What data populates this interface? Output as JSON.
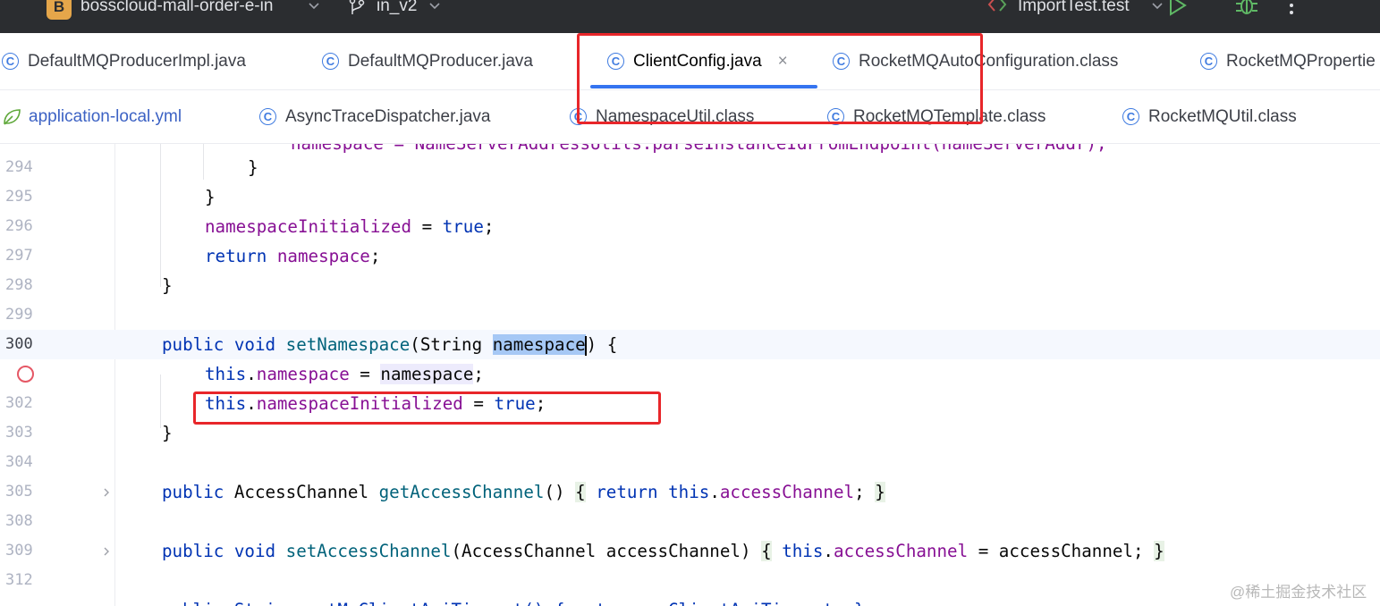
{
  "titlebar": {
    "project_badge": "B",
    "project_name": "bosscloud-mall-order-e-in",
    "branch": "in_v2",
    "run_config": "ImportTest.test",
    "play_icon": "play-icon",
    "debug_icon": "bug-icon",
    "more_icon": "more-vertical-icon",
    "badge_color": "#e5a64a"
  },
  "tabs_row1": [
    {
      "label": "DefaultMQProducerImpl.java",
      "icon": "class-icon"
    },
    {
      "label": "DefaultMQProducer.java",
      "icon": "class-icon"
    },
    {
      "label": "ClientConfig.java",
      "icon": "class-icon",
      "active": true,
      "close": "×"
    },
    {
      "label": "RocketMQAutoConfiguration.class",
      "icon": "class-icon"
    },
    {
      "label": "RocketMQPropertie",
      "icon": "class-icon"
    }
  ],
  "tabs_row2": [
    {
      "label": "application-local.yml",
      "icon": "spring-leaf-icon"
    },
    {
      "label": "AsyncTraceDispatcher.java",
      "icon": "class-icon"
    },
    {
      "label": "NamespaceUtil.class",
      "icon": "class-icon"
    },
    {
      "label": "RocketMQTemplate.class",
      "icon": "class-icon"
    },
    {
      "label": "RocketMQUtil.class",
      "icon": "class-icon"
    }
  ],
  "class_icon_glyph": "C",
  "editor": {
    "line_numbers": [
      "294",
      "295",
      "296",
      "297",
      "298",
      "299",
      "300",
      "",
      "302",
      "303",
      "304",
      "305",
      "308",
      "309",
      "312"
    ],
    "current_line": "300",
    "code": {
      "l293": "namespace = NameServerAddressUtils.parseInstanceIdFromEndpoint(nameServerAddr);",
      "l294": "}",
      "l295": "}",
      "l296_field": "namespaceInitialized",
      "l296_rest": " = ",
      "l296_val": "true",
      "l296_end": ";",
      "l297_kw": "return",
      "l297_field": "namespace",
      "l297_end": ";",
      "l298": "}",
      "l300_kw1": "public",
      "l300_kw2": "void",
      "l300_method": "setNamespace",
      "l300_sig": "(String ",
      "l300_param": "namespace",
      "l300_end": ") {",
      "l301_this": "this",
      "l301_dot": ".",
      "l301_field": "namespace",
      "l301_eq": " = ",
      "l301_param": "namespace",
      "l301_end": ";",
      "l302_this": "this",
      "l302_dot": ".",
      "l302_field": "namespaceInitialized",
      "l302_eq": " = ",
      "l302_val": "true",
      "l302_end": ";",
      "l303": "}",
      "l305_kw": "public",
      "l305_type": " AccessChannel ",
      "l305_method": "getAccessChannel",
      "l305_parens": "() ",
      "l305_ob": "{",
      "l305_ret": "return",
      "l305_this": "this",
      "l305_dot": ".",
      "l305_field": "accessChannel",
      "l305_semi": ";",
      "l305_cb": "}",
      "l309_kw1": "public",
      "l309_kw2": "void",
      "l309_method": "setAccessChannel",
      "l309_sig": "(AccessChannel accessChannel) ",
      "l309_ob": "{",
      "l309_this": "this",
      "l309_dot": ".",
      "l309_field": "accessChannel",
      "l309_rest": " = accessChannel",
      "l309_semi": ";",
      "l309_cb": "}",
      "l313": "public String getMqClientApiTimeout() { return mqClientApiTimeout; }"
    }
  },
  "watermark": "@稀土掘金技术社区",
  "annotation_color": "#e8262a"
}
